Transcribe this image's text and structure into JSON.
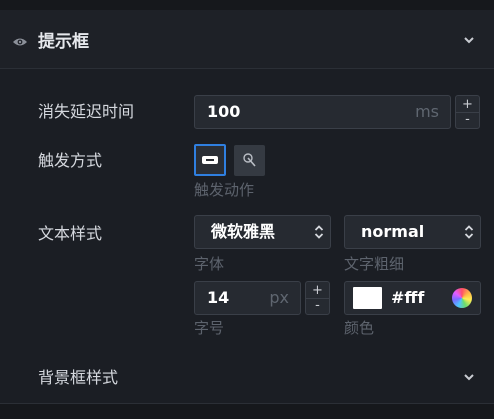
{
  "panel": {
    "title": "提示框"
  },
  "delay": {
    "label": "消失延迟时间",
    "value": "100",
    "unit": "ms",
    "plus": "+",
    "minus": "-"
  },
  "trigger": {
    "label": "触发方式",
    "sublabel": "触发动作"
  },
  "text_style": {
    "label": "文本样式",
    "font_family": {
      "value": "微软雅黑",
      "sublabel": "字体"
    },
    "font_weight": {
      "value": "normal",
      "sublabel": "文字粗细"
    },
    "font_size": {
      "value": "14",
      "unit": "px",
      "plus": "+",
      "minus": "-",
      "sublabel": "字号"
    },
    "color": {
      "value": "#fff",
      "sublabel": "颜色",
      "swatch": "#ffffff"
    }
  },
  "background": {
    "label": "背景框样式"
  }
}
